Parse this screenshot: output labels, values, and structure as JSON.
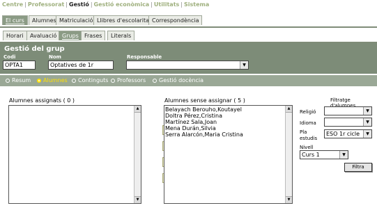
{
  "top_menu": {
    "items": [
      {
        "label": "Centre",
        "active": false
      },
      {
        "label": "Professorat",
        "active": false
      },
      {
        "label": "Gestió",
        "active": true
      },
      {
        "label": "Gestió econòmica",
        "active": false
      },
      {
        "label": "Utilitats",
        "active": false
      },
      {
        "label": "Sistema",
        "active": false
      }
    ],
    "separator": "|"
  },
  "tabs_primary": [
    "El curs",
    "Alumnes",
    "Matriculació",
    "Llibres d'escolaritat",
    "Correspondència"
  ],
  "tabs_primary_selected": 0,
  "tabs_secondary": [
    "Horari",
    "Avaluació",
    "Grups",
    "Frases",
    "Literals"
  ],
  "tabs_secondary_selected": 2,
  "header": {
    "title": "Gestió del grup",
    "codi_label": "Codi",
    "codi_value": "OPTA1",
    "nom_label": "Nom",
    "nom_value": "Optatives de 1r",
    "responsable_label": "Responsable",
    "responsable_value": ""
  },
  "radio_options": [
    "Resum",
    "Alumnes",
    "Continguts",
    "Professors",
    "Gestió docència"
  ],
  "radio_selected": 1,
  "assigned": {
    "label": "Alumnes assignats ( 0 )",
    "items": []
  },
  "unassigned": {
    "label": "Alumnes sense assignar ( 5 )",
    "items": [
      "Belayach Berouho,Koutayel",
      "Doltra Pérez,Cristina",
      "Martínez Sala,Joan",
      "Mena Durán,Silvia",
      "Serra Alarcón,Maria Cristina"
    ]
  },
  "move_buttons": {
    "add_one": "◁",
    "add_all": "◁◁",
    "remove_all": "▷▷",
    "remove_one": "▷"
  },
  "filter": {
    "title": "Filtratge d'alumnes",
    "religio_label": "Religió",
    "religio_value": "",
    "idioma_label": "Idioma",
    "idioma_value": "",
    "pla_label_1": "Pla",
    "pla_label_2": "estudis",
    "pla_value": "ESO 1r cicle",
    "nivell_label": "Nivell",
    "nivell_value": "Curs 1",
    "button_label": "Filtra"
  },
  "colors": {
    "header_bg": "#7d8c78",
    "radio_bg": "#9aa896",
    "accent_yellow": "#ffe000",
    "menu_green": "#9fb07e"
  }
}
